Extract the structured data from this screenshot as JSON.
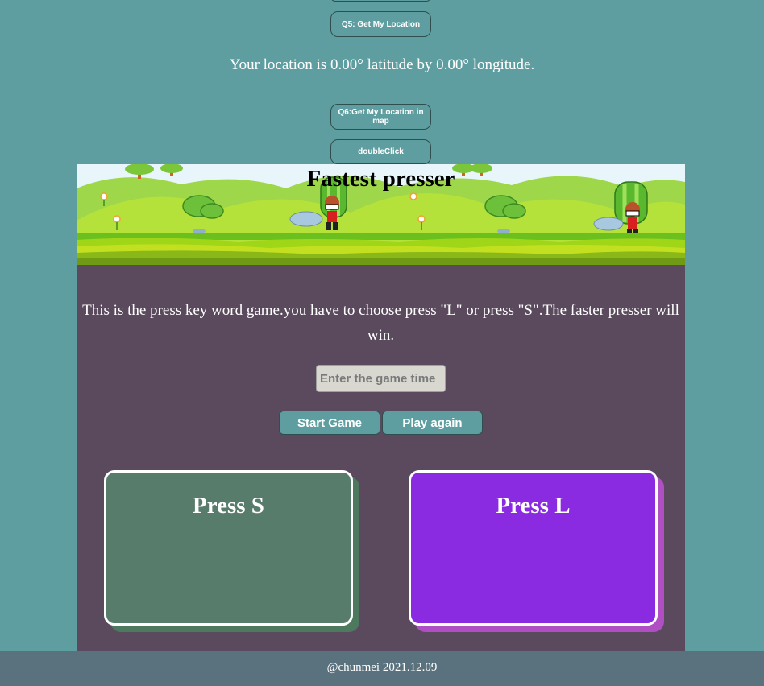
{
  "header": {
    "q5_label": "Q5: Get My Location",
    "location_text": "Your location is 0.00° latitude by 0.00° longitude.",
    "q6_label": "Q6:Get My Location in map",
    "doubleclick_label": "doubleClick"
  },
  "game": {
    "title": "Fastest presser",
    "instructions": "This is the press key word game.you have to choose press \"L\" or press \"S\".The faster presser will win.",
    "time_placeholder": "Enter the game time",
    "start_label": "Start Game",
    "again_label": "Play again",
    "press_s_label": "Press S",
    "press_l_label": "Press L",
    "colors": {
      "panel": "#5b4a5d",
      "press_s": "#587c6c",
      "press_l": "#8a2be2"
    }
  },
  "footer": {
    "text": "@chunmei 2021.12.09"
  },
  "colors": {
    "page_background": "#5f9ea0",
    "footer": "#5a727e"
  }
}
